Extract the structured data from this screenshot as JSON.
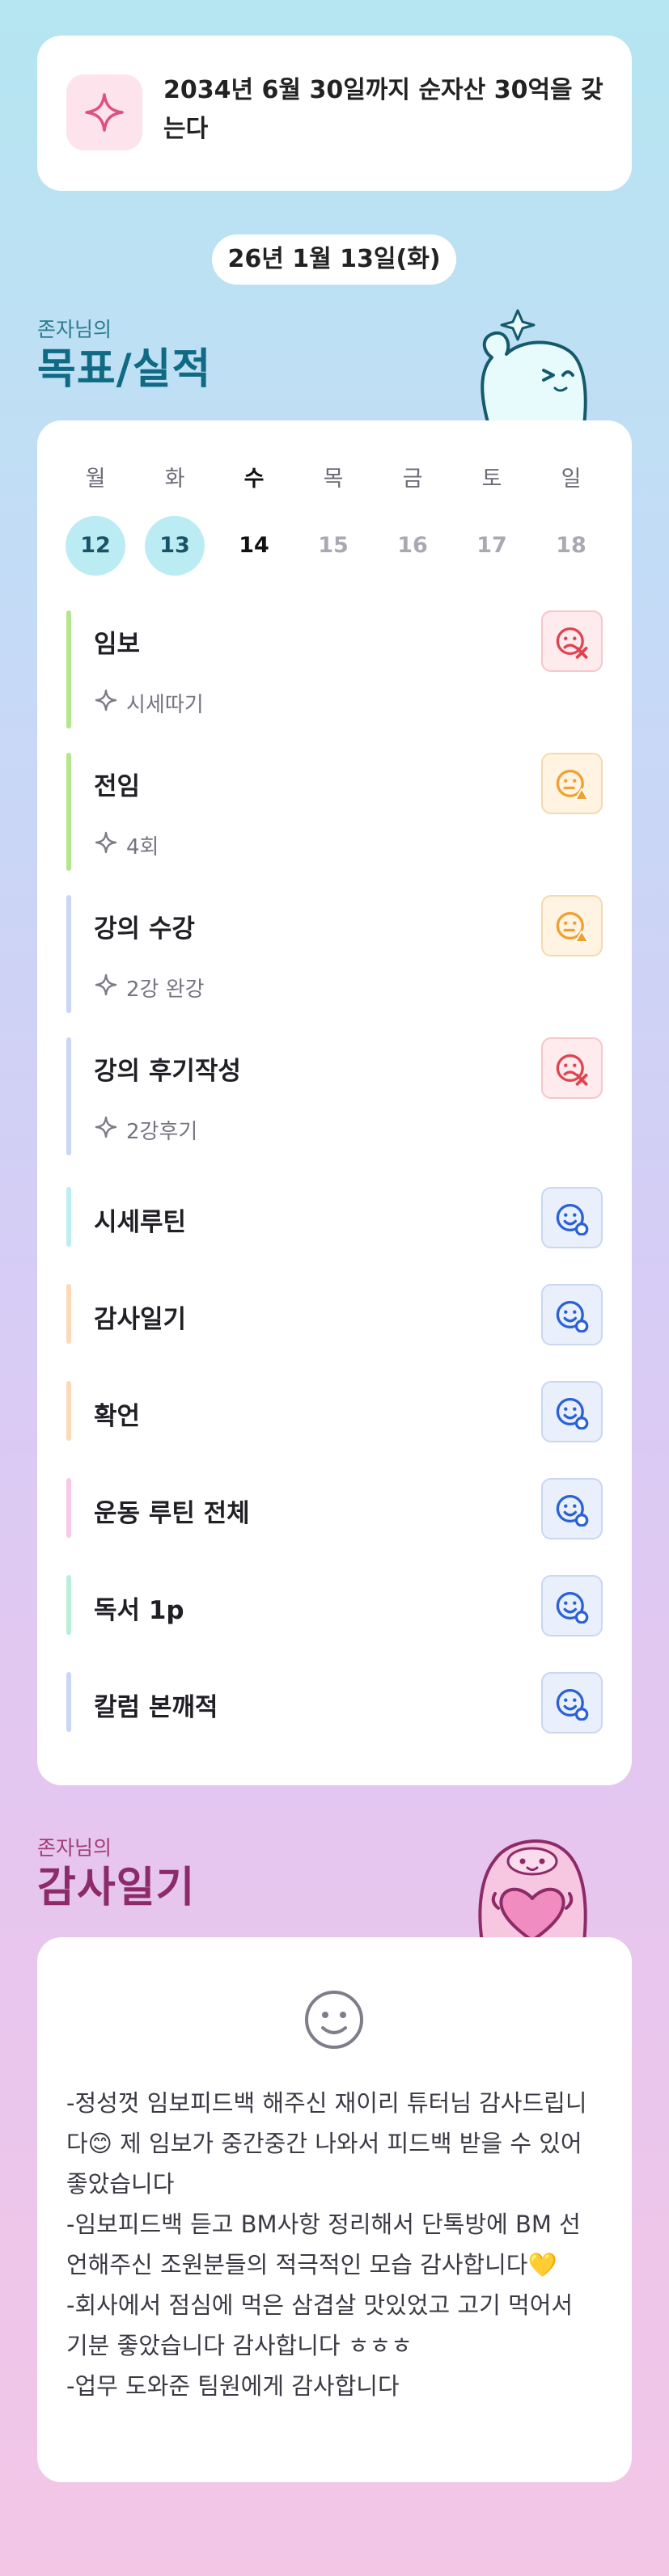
{
  "goal": {
    "icon": "sparkle-icon",
    "text": "2034년 6월 30일까지 순자산 30억을 갖는다"
  },
  "date_label": "26년 1월 13일(화)",
  "goals_section": {
    "subtitle": "존자님의",
    "title": "목표/실적"
  },
  "week": {
    "days": [
      {
        "day": "월",
        "date": "12",
        "state": "done"
      },
      {
        "day": "화",
        "date": "13",
        "state": "done"
      },
      {
        "day": "수",
        "date": "14",
        "state": "today"
      },
      {
        "day": "목",
        "date": "15",
        "state": "future"
      },
      {
        "day": "금",
        "date": "16",
        "state": "future"
      },
      {
        "day": "토",
        "date": "17",
        "state": "future"
      },
      {
        "day": "일",
        "date": "18",
        "state": "future"
      }
    ]
  },
  "tasks": [
    {
      "title": "임보",
      "detail": "시세따기",
      "bar_color": "#b5e68b",
      "status": "bad"
    },
    {
      "title": "전임",
      "detail": "4회",
      "bar_color": "#b5e68b",
      "status": "mid"
    },
    {
      "title": "강의 수강",
      "detail": "2강 완강",
      "bar_color": "#c9d6f7",
      "status": "mid"
    },
    {
      "title": "강의 후기작성",
      "detail": "2강후기",
      "bar_color": "#c9d6f7",
      "status": "bad"
    },
    {
      "title": "시세루틴",
      "detail": "",
      "bar_color": "#bdeef3",
      "status": "good"
    },
    {
      "title": "감사일기",
      "detail": "",
      "bar_color": "#fcd9b8",
      "status": "good"
    },
    {
      "title": "확언",
      "detail": "",
      "bar_color": "#fcd9b8",
      "status": "good"
    },
    {
      "title": "운동 루틴 전체",
      "detail": "",
      "bar_color": "#f8c8e6",
      "status": "good"
    },
    {
      "title": "독서 1p",
      "detail": "",
      "bar_color": "#b9efd9",
      "status": "good"
    },
    {
      "title": "칼럼 본깨적",
      "detail": "",
      "bar_color": "#c9d6f7",
      "status": "good"
    }
  ],
  "status_colors": {
    "bad": "#e0434f",
    "mid": "#f0a030",
    "good": "#2a62d6"
  },
  "gratitude_section": {
    "subtitle": "존자님의",
    "title": "감사일기",
    "text": "-정성껏 임보피드백 해주신 재이리 튜터님 감사드립니다😊 제 임보가 중간중간 나와서 피드백 받을 수 있어 좋았습니다\n-임보피드백 듣고 BM사항 정리해서 단톡방에 BM 선언해주신 조원분들의 적극적인 모습 감사합니다💛\n-회사에서 점심에 먹은 삼겹살 맛있었고 고기 먹어서 기분 좋았습니다 감사합니다 ㅎㅎㅎ\n-업무 도와준 팀원에게 감사합니다"
  }
}
